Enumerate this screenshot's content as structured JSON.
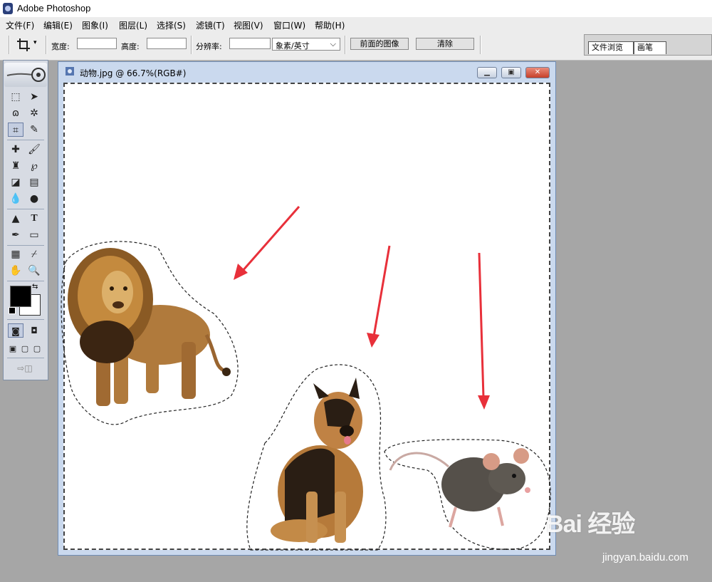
{
  "app": {
    "title": "Adobe Photoshop",
    "icon": "photoshop-logo-icon"
  },
  "menu": [
    {
      "label": "文件(F)"
    },
    {
      "label": "编辑(E)"
    },
    {
      "label": "图象(I)"
    },
    {
      "label": "图层(L)"
    },
    {
      "label": "选择(S)"
    },
    {
      "label": "滤镜(T)"
    },
    {
      "label": "视图(V)"
    },
    {
      "label": "窗口(W)"
    },
    {
      "label": "帮助(H)"
    }
  ],
  "options_bar": {
    "tool_icon": "crop-icon",
    "width_label": "宽度:",
    "width_value": "",
    "height_label": "高度:",
    "height_value": "",
    "resolution_label": "分辨率:",
    "resolution_value": "",
    "unit_value": "象素/英寸",
    "front_image_button": "前面的图像",
    "clear_button": "清除"
  },
  "palette_well": {
    "tabs": [
      "文件浏览",
      "画笔"
    ]
  },
  "toolbox": {
    "active_tool": "crop",
    "foreground_color": "#000000",
    "background_color": "#ffffff"
  },
  "document": {
    "title": "动物.jpg @ 66.7%(RGB#)",
    "buttons": [
      "minimize",
      "restore",
      "close"
    ],
    "content": [
      "lion",
      "german-shepherd-dog",
      "rat"
    ],
    "annotation_color": "#e8303a"
  },
  "watermark": {
    "logo": "Bai 经验",
    "url": "jingyan.baidu.com"
  }
}
